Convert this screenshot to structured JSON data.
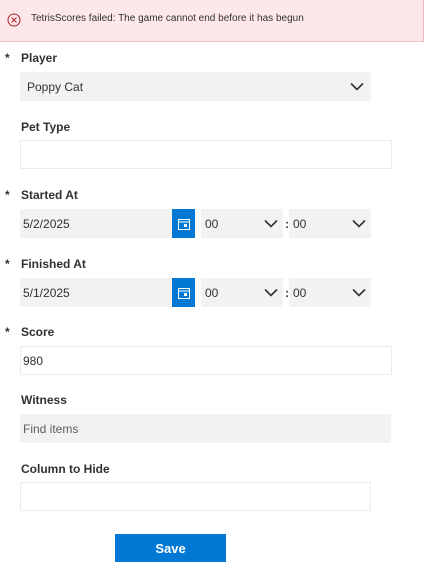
{
  "error": {
    "message": "TetrisScores failed: The game cannot end before it has begun",
    "icon": "error-circle-icon"
  },
  "form": {
    "player": {
      "label": "Player",
      "required": "*",
      "value": "Poppy Cat"
    },
    "pet_type": {
      "label": "Pet Type",
      "value": ""
    },
    "started_at": {
      "label": "Started At",
      "required": "*",
      "date": "5/2/2025",
      "hour": "00",
      "minute": "00",
      "separator": ":"
    },
    "finished_at": {
      "label": "Finished At",
      "required": "*",
      "date": "5/1/2025",
      "hour": "00",
      "minute": "00",
      "separator": ":"
    },
    "score": {
      "label": "Score",
      "required": "*",
      "value": "980"
    },
    "witness": {
      "label": "Witness",
      "placeholder": "Find items"
    },
    "column_to_hide": {
      "label": "Column to Hide",
      "value": ""
    },
    "save_label": "Save"
  },
  "colors": {
    "accent": "#0078d4",
    "error_bg": "#fde7e9",
    "field_bg": "#f3f2f1"
  }
}
